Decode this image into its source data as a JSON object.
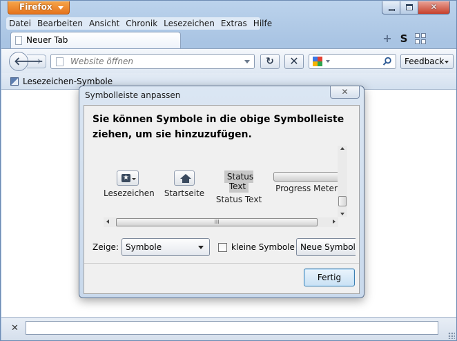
{
  "window": {
    "app_button": "Firefox"
  },
  "menubar": {
    "items": [
      "Datei",
      "Bearbeiten",
      "Ansicht",
      "Chronik",
      "Lesezeichen",
      "Extras",
      "Hilfe"
    ]
  },
  "tabs": [
    {
      "label": "Neuer Tab"
    }
  ],
  "navbar": {
    "url_placeholder": "Website öffnen",
    "search_placeholder": "",
    "feedback_label": "Feedback"
  },
  "bookmarks_bar": {
    "item": "Lesezeichen-Symbole"
  },
  "dialog": {
    "title": "Symbolleiste anpassen",
    "heading": "Sie können Symbole in die obige Symbolleiste ziehen, um sie hinzuzufügen.",
    "palette": [
      {
        "label": "Lesezeichen",
        "icon": "bookmark-star-icon"
      },
      {
        "label": "Startseite",
        "icon": "home-icon"
      },
      {
        "label": "Status Text",
        "sample": "Status Text"
      },
      {
        "label": "Progress Meter",
        "icon": "progress-meter"
      }
    ],
    "show_label": "Zeige:",
    "show_value": "Symbole",
    "small_icons_label": "kleine Symbole",
    "new_toolbar_label": "Neue Symbolleiste",
    "done_label": "Fertig",
    "hscroll_grip": "III"
  },
  "colors": {
    "firefox_button": "#e5731c",
    "frame": "#a9c4e3",
    "close_button": "#c6402b"
  }
}
